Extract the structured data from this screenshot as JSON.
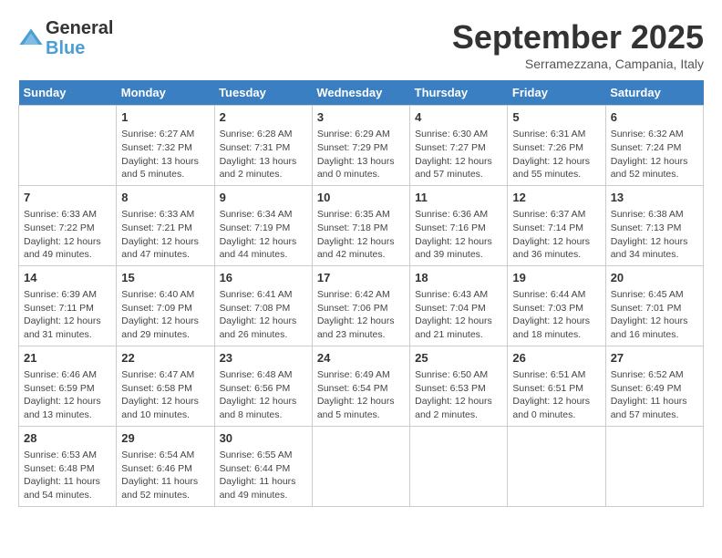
{
  "header": {
    "logo_line1": "General",
    "logo_line2": "Blue",
    "month_title": "September 2025",
    "location": "Serramezzana, Campania, Italy"
  },
  "days_of_week": [
    "Sunday",
    "Monday",
    "Tuesday",
    "Wednesday",
    "Thursday",
    "Friday",
    "Saturday"
  ],
  "weeks": [
    [
      {
        "day": "",
        "info": ""
      },
      {
        "day": "1",
        "info": "Sunrise: 6:27 AM\nSunset: 7:32 PM\nDaylight: 13 hours\nand 5 minutes."
      },
      {
        "day": "2",
        "info": "Sunrise: 6:28 AM\nSunset: 7:31 PM\nDaylight: 13 hours\nand 2 minutes."
      },
      {
        "day": "3",
        "info": "Sunrise: 6:29 AM\nSunset: 7:29 PM\nDaylight: 13 hours\nand 0 minutes."
      },
      {
        "day": "4",
        "info": "Sunrise: 6:30 AM\nSunset: 7:27 PM\nDaylight: 12 hours\nand 57 minutes."
      },
      {
        "day": "5",
        "info": "Sunrise: 6:31 AM\nSunset: 7:26 PM\nDaylight: 12 hours\nand 55 minutes."
      },
      {
        "day": "6",
        "info": "Sunrise: 6:32 AM\nSunset: 7:24 PM\nDaylight: 12 hours\nand 52 minutes."
      }
    ],
    [
      {
        "day": "7",
        "info": "Sunrise: 6:33 AM\nSunset: 7:22 PM\nDaylight: 12 hours\nand 49 minutes."
      },
      {
        "day": "8",
        "info": "Sunrise: 6:33 AM\nSunset: 7:21 PM\nDaylight: 12 hours\nand 47 minutes."
      },
      {
        "day": "9",
        "info": "Sunrise: 6:34 AM\nSunset: 7:19 PM\nDaylight: 12 hours\nand 44 minutes."
      },
      {
        "day": "10",
        "info": "Sunrise: 6:35 AM\nSunset: 7:18 PM\nDaylight: 12 hours\nand 42 minutes."
      },
      {
        "day": "11",
        "info": "Sunrise: 6:36 AM\nSunset: 7:16 PM\nDaylight: 12 hours\nand 39 minutes."
      },
      {
        "day": "12",
        "info": "Sunrise: 6:37 AM\nSunset: 7:14 PM\nDaylight: 12 hours\nand 36 minutes."
      },
      {
        "day": "13",
        "info": "Sunrise: 6:38 AM\nSunset: 7:13 PM\nDaylight: 12 hours\nand 34 minutes."
      }
    ],
    [
      {
        "day": "14",
        "info": "Sunrise: 6:39 AM\nSunset: 7:11 PM\nDaylight: 12 hours\nand 31 minutes."
      },
      {
        "day": "15",
        "info": "Sunrise: 6:40 AM\nSunset: 7:09 PM\nDaylight: 12 hours\nand 29 minutes."
      },
      {
        "day": "16",
        "info": "Sunrise: 6:41 AM\nSunset: 7:08 PM\nDaylight: 12 hours\nand 26 minutes."
      },
      {
        "day": "17",
        "info": "Sunrise: 6:42 AM\nSunset: 7:06 PM\nDaylight: 12 hours\nand 23 minutes."
      },
      {
        "day": "18",
        "info": "Sunrise: 6:43 AM\nSunset: 7:04 PM\nDaylight: 12 hours\nand 21 minutes."
      },
      {
        "day": "19",
        "info": "Sunrise: 6:44 AM\nSunset: 7:03 PM\nDaylight: 12 hours\nand 18 minutes."
      },
      {
        "day": "20",
        "info": "Sunrise: 6:45 AM\nSunset: 7:01 PM\nDaylight: 12 hours\nand 16 minutes."
      }
    ],
    [
      {
        "day": "21",
        "info": "Sunrise: 6:46 AM\nSunset: 6:59 PM\nDaylight: 12 hours\nand 13 minutes."
      },
      {
        "day": "22",
        "info": "Sunrise: 6:47 AM\nSunset: 6:58 PM\nDaylight: 12 hours\nand 10 minutes."
      },
      {
        "day": "23",
        "info": "Sunrise: 6:48 AM\nSunset: 6:56 PM\nDaylight: 12 hours\nand 8 minutes."
      },
      {
        "day": "24",
        "info": "Sunrise: 6:49 AM\nSunset: 6:54 PM\nDaylight: 12 hours\nand 5 minutes."
      },
      {
        "day": "25",
        "info": "Sunrise: 6:50 AM\nSunset: 6:53 PM\nDaylight: 12 hours\nand 2 minutes."
      },
      {
        "day": "26",
        "info": "Sunrise: 6:51 AM\nSunset: 6:51 PM\nDaylight: 12 hours\nand 0 minutes."
      },
      {
        "day": "27",
        "info": "Sunrise: 6:52 AM\nSunset: 6:49 PM\nDaylight: 11 hours\nand 57 minutes."
      }
    ],
    [
      {
        "day": "28",
        "info": "Sunrise: 6:53 AM\nSunset: 6:48 PM\nDaylight: 11 hours\nand 54 minutes."
      },
      {
        "day": "29",
        "info": "Sunrise: 6:54 AM\nSunset: 6:46 PM\nDaylight: 11 hours\nand 52 minutes."
      },
      {
        "day": "30",
        "info": "Sunrise: 6:55 AM\nSunset: 6:44 PM\nDaylight: 11 hours\nand 49 minutes."
      },
      {
        "day": "",
        "info": ""
      },
      {
        "day": "",
        "info": ""
      },
      {
        "day": "",
        "info": ""
      },
      {
        "day": "",
        "info": ""
      }
    ]
  ]
}
